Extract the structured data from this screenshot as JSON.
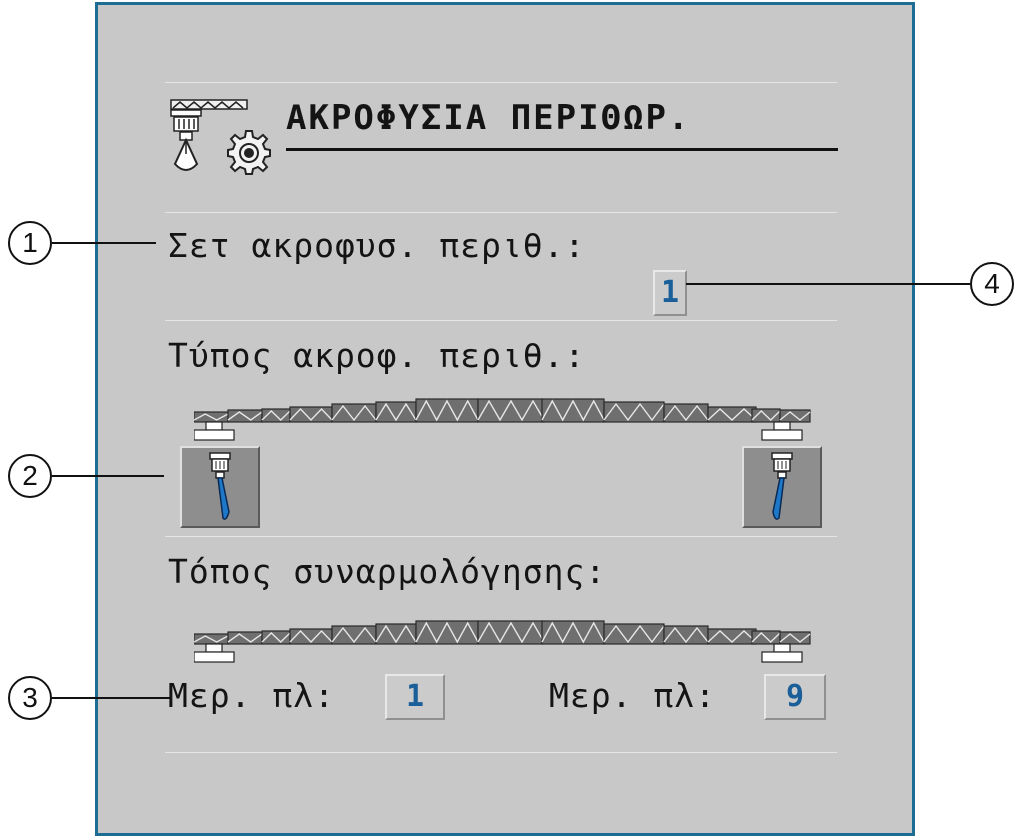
{
  "header": {
    "title": "ΑΚΡΟΦΥΣΙΑ ΠΕΡΙΘΩΡ."
  },
  "icons": {
    "header_icon": "boom-nozzle-icon",
    "settings_icon": "gear-icon"
  },
  "boundary_nozzle_set": {
    "label": "Σετ ακροφυσ. περιθ.:",
    "value": "1"
  },
  "boundary_nozzle_type": {
    "label": "Τύπος ακροφ. περιθ.:"
  },
  "mounting_location": {
    "label": "Τόπος συναρμολόγησης:",
    "left": {
      "label": "Μερ. πλ:",
      "value": "1"
    },
    "right": {
      "label": "Μερ. πλ:",
      "value": "9"
    }
  },
  "callouts": [
    "1",
    "2",
    "3",
    "4"
  ],
  "colors": {
    "panel_bg": "#c8c8c8",
    "frame": "#1d6c93",
    "value_text": "#1a5f99",
    "nozzle_spray": "#1e78c8"
  }
}
